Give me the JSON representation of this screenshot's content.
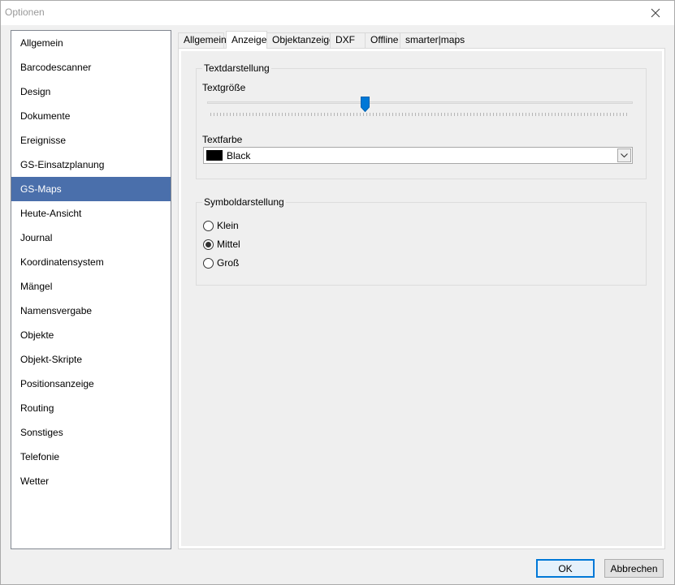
{
  "window": {
    "title": "Optionen",
    "close_glyph": "×"
  },
  "sidebar": {
    "items": [
      {
        "label": "Allgemein"
      },
      {
        "label": "Barcodescanner"
      },
      {
        "label": "Design"
      },
      {
        "label": "Dokumente"
      },
      {
        "label": "Ereignisse"
      },
      {
        "label": "GS-Einsatzplanung"
      },
      {
        "label": "GS-Maps",
        "selected": true
      },
      {
        "label": "Heute-Ansicht"
      },
      {
        "label": "Journal"
      },
      {
        "label": "Koordinatensystem"
      },
      {
        "label": "Mängel"
      },
      {
        "label": "Namensvergabe"
      },
      {
        "label": "Objekte"
      },
      {
        "label": "Objekt-Skripte"
      },
      {
        "label": "Positionsanzeige"
      },
      {
        "label": "Routing"
      },
      {
        "label": "Sonstiges"
      },
      {
        "label": "Telefonie"
      },
      {
        "label": "Wetter"
      }
    ],
    "selected_color": "#4a6fab"
  },
  "tabs": [
    {
      "label": "Allgemein"
    },
    {
      "label": "Anzeige",
      "active": true
    },
    {
      "label": "Objektanzeige"
    },
    {
      "label": "DXF"
    },
    {
      "label": "Offline"
    },
    {
      "label": "smarter|maps"
    }
  ],
  "text_group": {
    "title": "Textdarstellung",
    "size_label": "Textgröße",
    "slider_value_fraction": 0.37,
    "color_label": "Textfarbe",
    "color_value": "Black",
    "color_swatch": "#000000"
  },
  "symbol_group": {
    "title": "Symboldarstellung",
    "options": [
      {
        "label": "Klein",
        "checked": false
      },
      {
        "label": "Mittel",
        "checked": true
      },
      {
        "label": "Groß",
        "checked": false
      }
    ]
  },
  "buttons": {
    "ok": "OK",
    "cancel": "Abbrechen"
  },
  "accent_color": "#0078d7"
}
